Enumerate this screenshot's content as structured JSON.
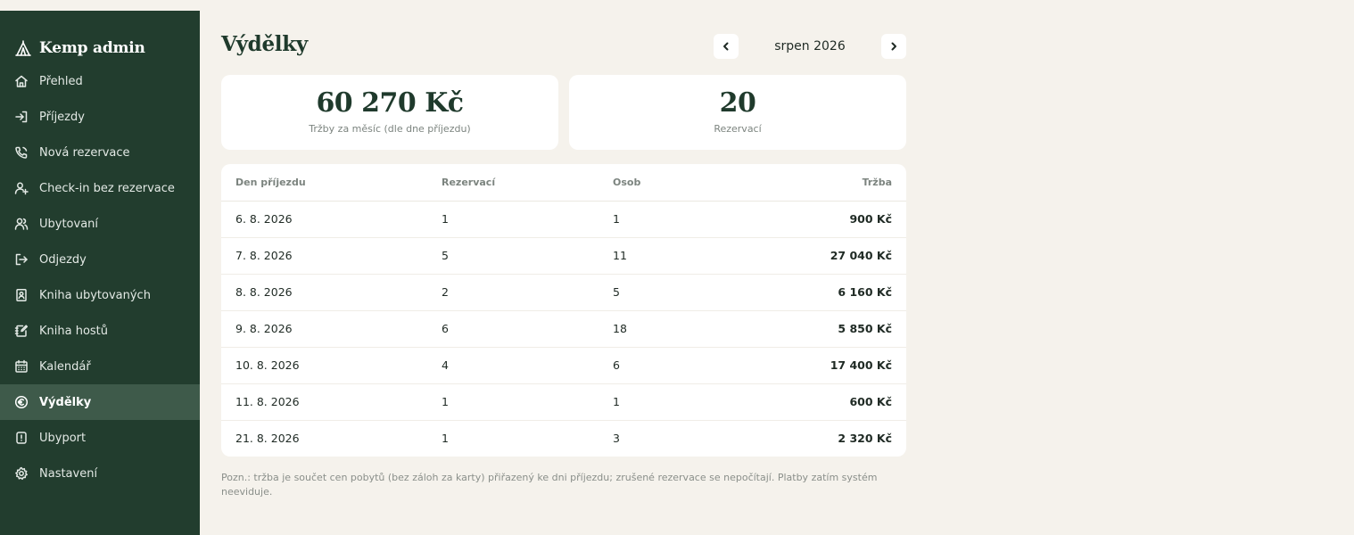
{
  "app": {
    "name": "Kemp admin",
    "logo_icon": "tent-icon"
  },
  "sidebar": {
    "items": [
      {
        "label": "Přehled",
        "icon": "home-icon",
        "active": false
      },
      {
        "label": "Příjezdy",
        "icon": "login-icon",
        "active": false
      },
      {
        "label": "Nová rezervace",
        "icon": "phone-icon",
        "active": false
      },
      {
        "label": "Check-in bez rezervace",
        "icon": "user-plus-icon",
        "active": false
      },
      {
        "label": "Ubytovaní",
        "icon": "users-icon",
        "active": false
      },
      {
        "label": "Odjezdy",
        "icon": "logout-icon",
        "active": false
      },
      {
        "label": "Kniha ubytovaných",
        "icon": "contact-book-icon",
        "active": false
      },
      {
        "label": "Kniha hostů",
        "icon": "notebook-pen-icon",
        "active": false
      },
      {
        "label": "Kalendář",
        "icon": "calendar-icon",
        "active": false
      },
      {
        "label": "Výdělky",
        "icon": "euro-icon",
        "active": true
      },
      {
        "label": "Ubyport",
        "icon": "alert-badge-icon",
        "active": false
      },
      {
        "label": "Nastavení",
        "icon": "gear-icon",
        "active": false
      }
    ]
  },
  "main": {
    "title": "Výdělky",
    "month": {
      "label": "srpen 2026",
      "prev_icon": "chevron-left-icon",
      "next_icon": "chevron-right-icon"
    },
    "cards": {
      "revenue": {
        "value": "60 270 Kč",
        "label": "Tržby za měsíc (dle dne příjezdu)"
      },
      "count": {
        "value": "20",
        "label": "Rezervací"
      }
    },
    "table": {
      "headers": [
        "Den příjezdu",
        "Rezervací",
        "Osob",
        "Tržba"
      ],
      "rows": [
        [
          "6. 8. 2026",
          "1",
          "1",
          "900 Kč"
        ],
        [
          "7. 8. 2026",
          "5",
          "11",
          "27 040 Kč"
        ],
        [
          "8. 8. 2026",
          "2",
          "5",
          "6 160 Kč"
        ],
        [
          "9. 8. 2026",
          "6",
          "18",
          "5 850 Kč"
        ],
        [
          "10. 8. 2026",
          "4",
          "6",
          "17 400 Kč"
        ],
        [
          "11. 8. 2026",
          "1",
          "1",
          "600 Kč"
        ],
        [
          "21. 8. 2026",
          "1",
          "3",
          "2 320 Kč"
        ]
      ]
    },
    "note": "Pozn.: tržba je součet cen pobytů (bez záloh za karty) přiřazený ke dni příjezdu; zrušené rezervace se nepočítají. Platby zatím systém neeviduje."
  },
  "colors": {
    "sidebar_bg": "#223d2e",
    "sidebar_active_bg": "#3e5a4a",
    "page_bg": "#f5f2ec",
    "title_color": "#1f3a2c"
  }
}
